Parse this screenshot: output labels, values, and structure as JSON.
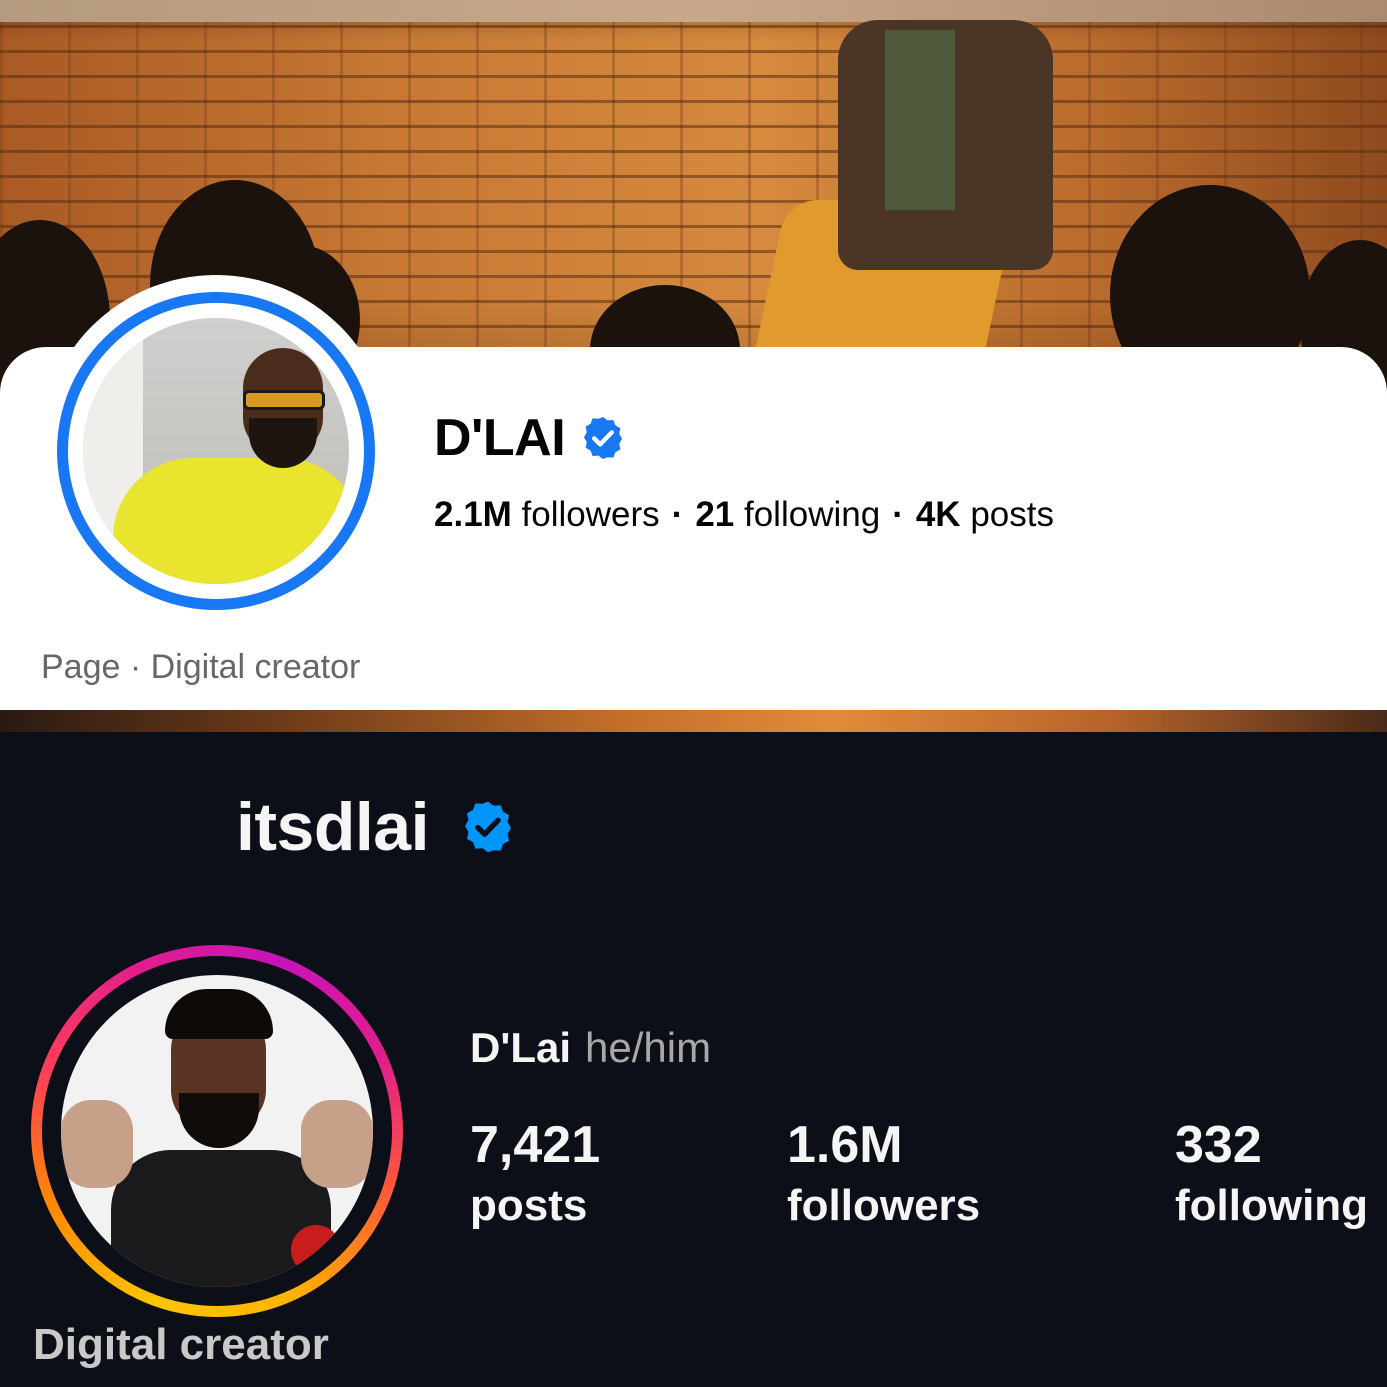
{
  "facebook": {
    "name": "D'LAI",
    "verified_icon": "verified-badge-icon",
    "stats": {
      "followers_value": "2.1M",
      "followers_label": "followers",
      "following_value": "21",
      "following_label": "following",
      "posts_value": "4K",
      "posts_label": "posts",
      "separator": "·"
    },
    "category": "Page · Digital creator",
    "colors": {
      "ring": "#1877f2",
      "text": "#050505",
      "muted": "#65676b"
    }
  },
  "instagram": {
    "username": "itsdlai",
    "verified_icon": "verified-badge-icon",
    "full_name": "D'Lai",
    "pronouns": "he/him",
    "stats": {
      "posts_value": "7,421",
      "posts_label": "posts",
      "followers_value": "1.6M",
      "followers_label": "followers",
      "following_value": "332",
      "following_label": "following"
    },
    "category": "Digital creator",
    "colors": {
      "background": "#0c0f17",
      "text": "#f5f5f5",
      "muted": "#a8a8a8",
      "verified": "#0095f6"
    }
  }
}
